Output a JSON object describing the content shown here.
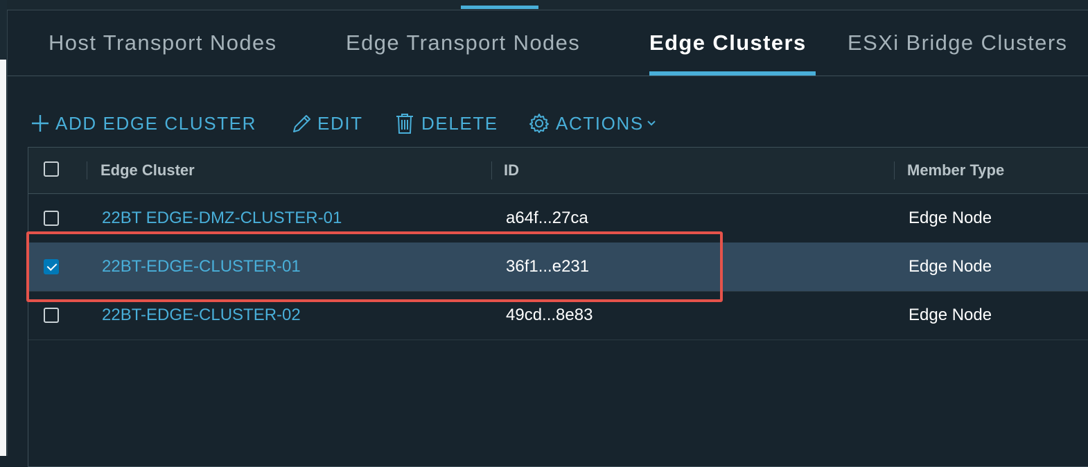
{
  "tabs": [
    {
      "label": "Host Transport Nodes"
    },
    {
      "label": "Edge Transport Nodes"
    },
    {
      "label": "Edge Clusters",
      "active": true
    },
    {
      "label": "ESXi Bridge Clusters"
    }
  ],
  "toolbar": {
    "add_label": "ADD EDGE CLUSTER",
    "edit_label": "EDIT",
    "delete_label": "DELETE",
    "actions_label": "ACTIONS"
  },
  "table": {
    "columns": [
      "Edge Cluster",
      "ID",
      "Member Type"
    ],
    "rows": [
      {
        "name": "22BT EDGE-DMZ-CLUSTER-01",
        "id": "a64f...27ca",
        "member_type": "Edge Node",
        "selected": false
      },
      {
        "name": "22BT-EDGE-CLUSTER-01",
        "id": "36f1...e231",
        "member_type": "Edge Node",
        "selected": true
      },
      {
        "name": "22BT-EDGE-CLUSTER-02",
        "id": "49cd...8e83",
        "member_type": "Edge Node",
        "selected": false
      }
    ]
  },
  "colors": {
    "background": "#17242d",
    "accent": "#49afd9",
    "selected_row": "#324a5e",
    "highlight_box": "#e5534b"
  },
  "icons": [
    "plus-icon",
    "pencil-icon",
    "trash-icon",
    "gear-icon",
    "chevron-down-icon"
  ]
}
